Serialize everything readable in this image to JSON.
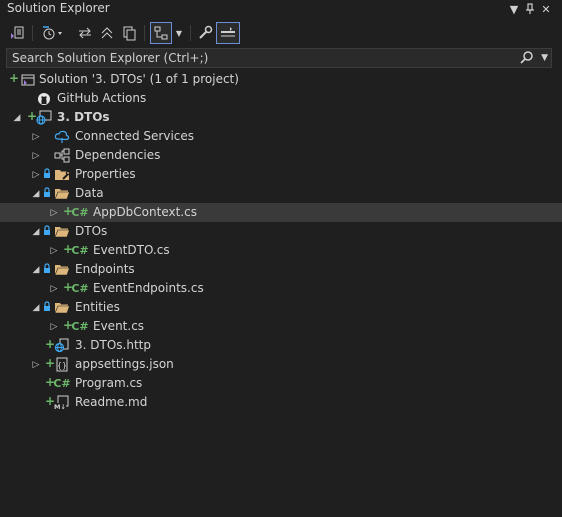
{
  "window": {
    "title": "Solution Explorer"
  },
  "search": {
    "placeholder": "Search Solution Explorer (Ctrl+;)"
  },
  "tree": {
    "solution": "Solution '3. DTOs' (1 of 1 project)",
    "github_actions": "GitHub Actions",
    "project": "3. DTOs",
    "connected_services": "Connected Services",
    "dependencies": "Dependencies",
    "properties": "Properties",
    "data_folder": "Data",
    "appdbcontext": "AppDbContext.cs",
    "dtos_folder": "DTOs",
    "eventdto": "EventDTO.cs",
    "endpoints_folder": "Endpoints",
    "eventendpoints": "EventEndpoints.cs",
    "entities_folder": "Entities",
    "event": "Event.cs",
    "http_file": "3. DTOs.http",
    "appsettings": "appsettings.json",
    "program": "Program.cs",
    "readme": "Readme.md",
    "cs_glyph": "C#"
  },
  "colors": {
    "background": "#1f1f1f",
    "selected_row": "#3a3a3a",
    "git_added": "#6cb66a",
    "folder": "#dcb67a",
    "accent": "#6b8ed6"
  }
}
